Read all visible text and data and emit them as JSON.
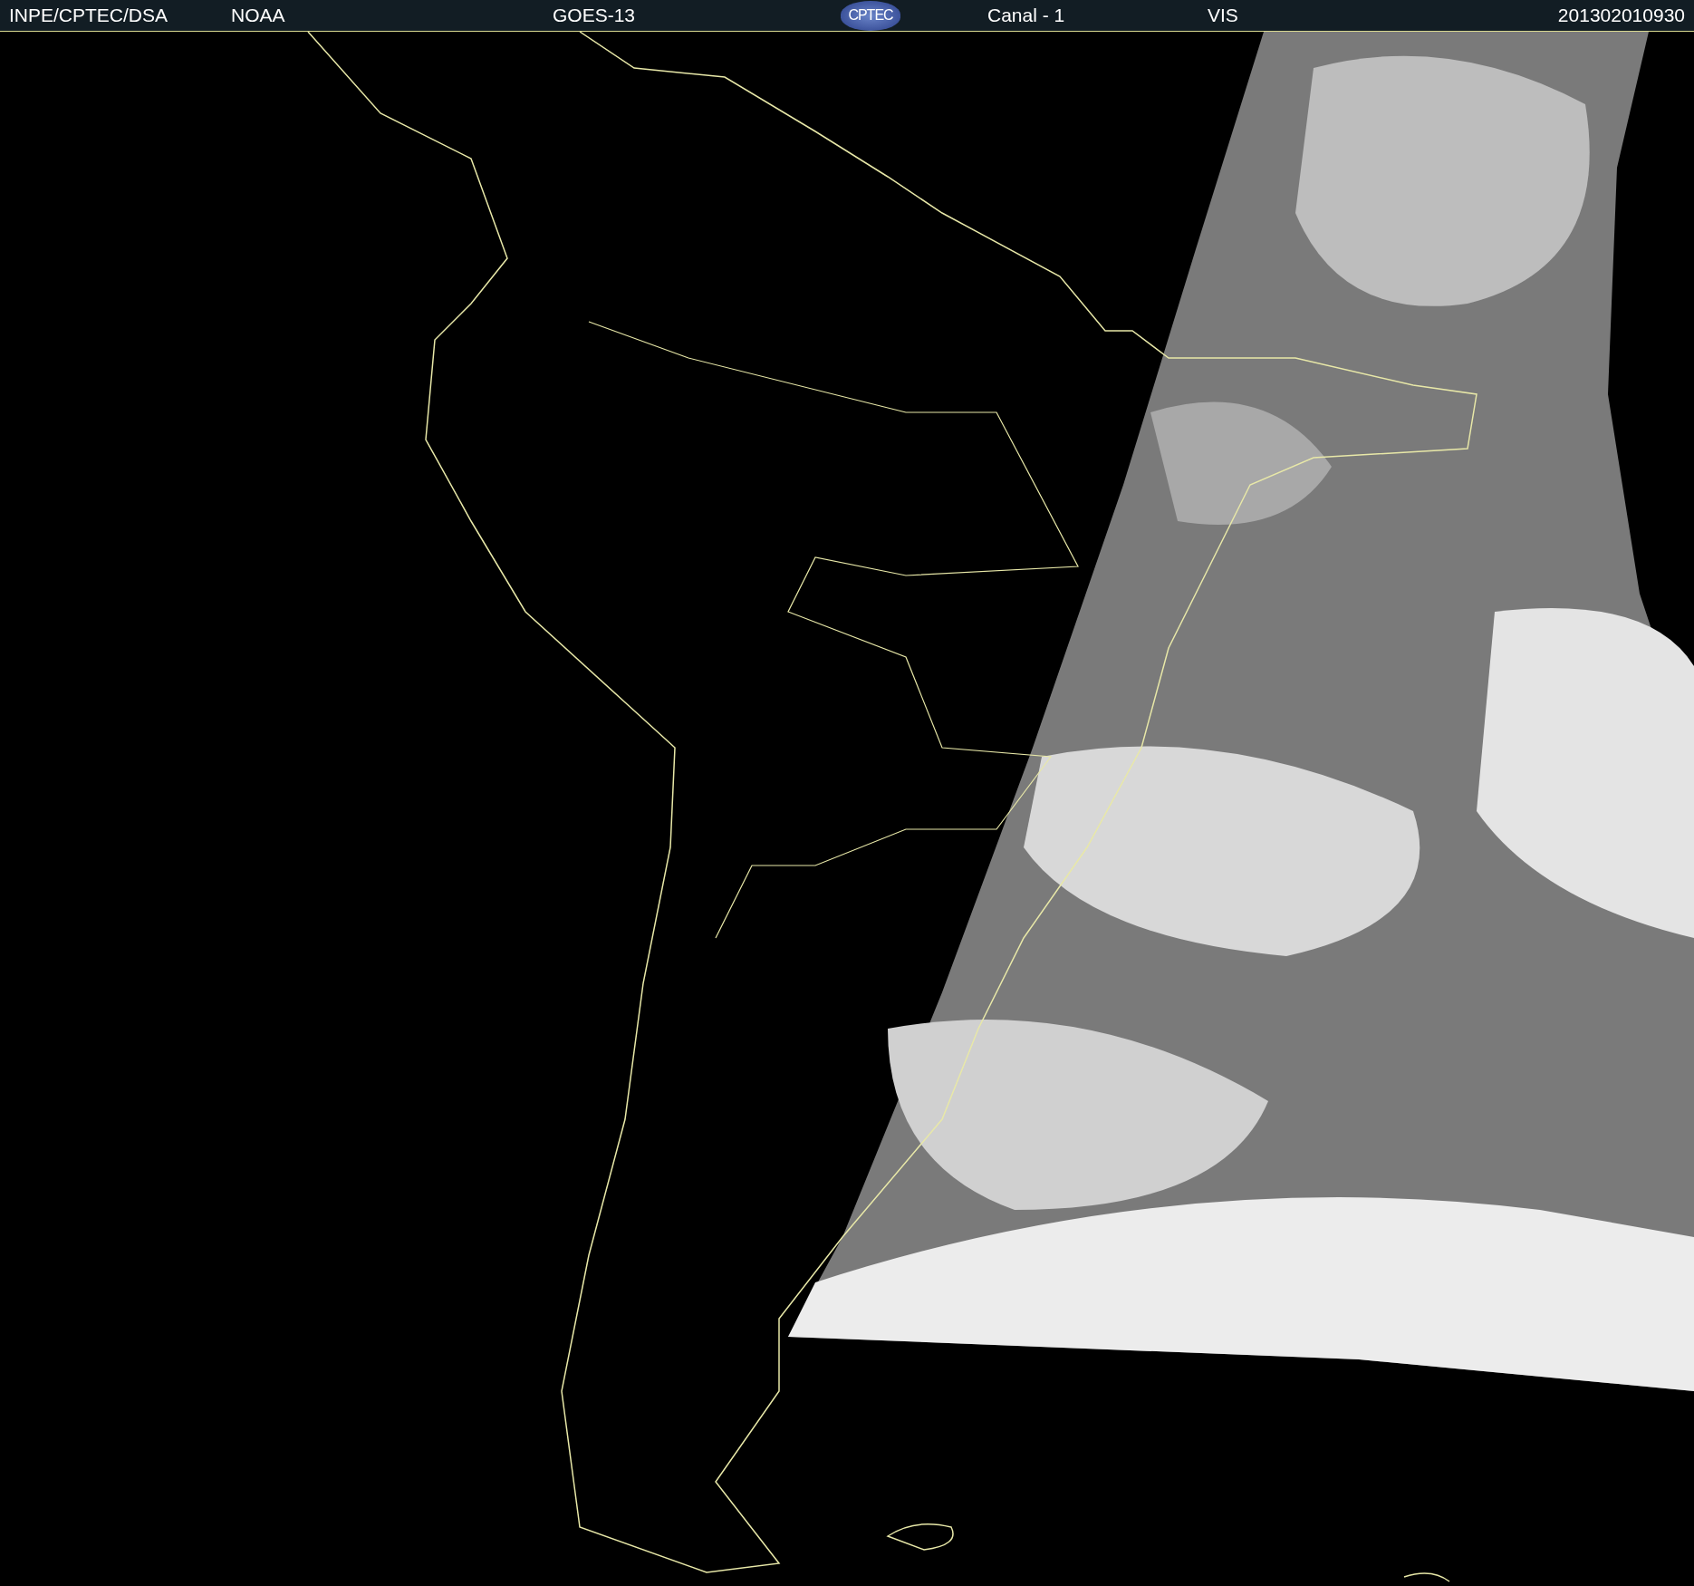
{
  "header": {
    "source": "INPE/CPTEC/DSA",
    "agency": "NOAA",
    "satellite": "GOES-13",
    "logo": "CPTEC",
    "channel": "Canal - 1",
    "band": "VIS",
    "timestamp": "201302010930"
  }
}
